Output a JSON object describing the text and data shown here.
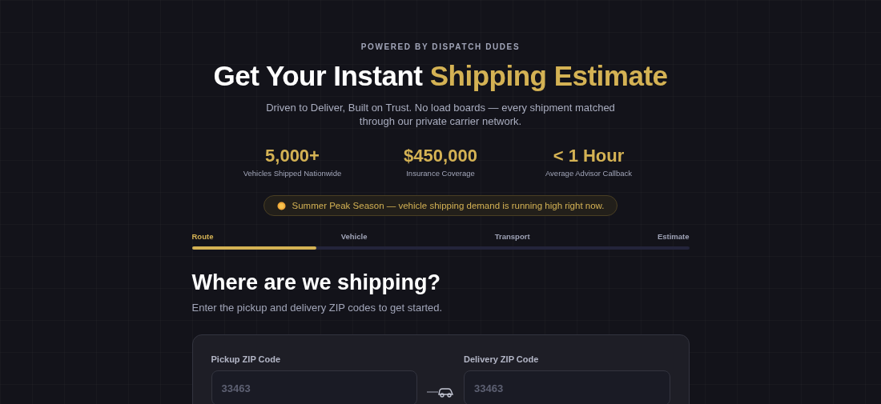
{
  "eyebrow": "POWERED BY DISPATCH DUDES",
  "title": {
    "lead": "Get Your Instant",
    "highlight": "Shipping Estimate"
  },
  "subtitle": "Driven to Deliver, Built on Trust. No load boards — every shipment matched through our private carrier network.",
  "stats": [
    {
      "value": "5,000+",
      "label": "Vehicles Shipped Nationwide"
    },
    {
      "value": "$450,000",
      "label": "Insurance Coverage"
    },
    {
      "value": "< 1 Hour",
      "label": "Average Advisor Callback"
    }
  ],
  "notice": {
    "text": "Summer Peak Season — vehicle shipping demand is running high right now."
  },
  "steps": [
    {
      "label": "Route",
      "selected": true
    },
    {
      "label": "Vehicle",
      "selected": false
    },
    {
      "label": "Transport",
      "selected": false
    },
    {
      "label": "Estimate",
      "selected": false
    }
  ],
  "progress": {
    "level": 0.25
  },
  "section": {
    "heading": "Where are we shipping?",
    "description": "Enter the pickup and delivery ZIP codes to get started."
  },
  "fields": [
    {
      "label": "Pickup ZIP Code",
      "placeholder": "33463"
    },
    {
      "label": "Delivery ZIP Code",
      "placeholder": "33463"
    }
  ]
}
